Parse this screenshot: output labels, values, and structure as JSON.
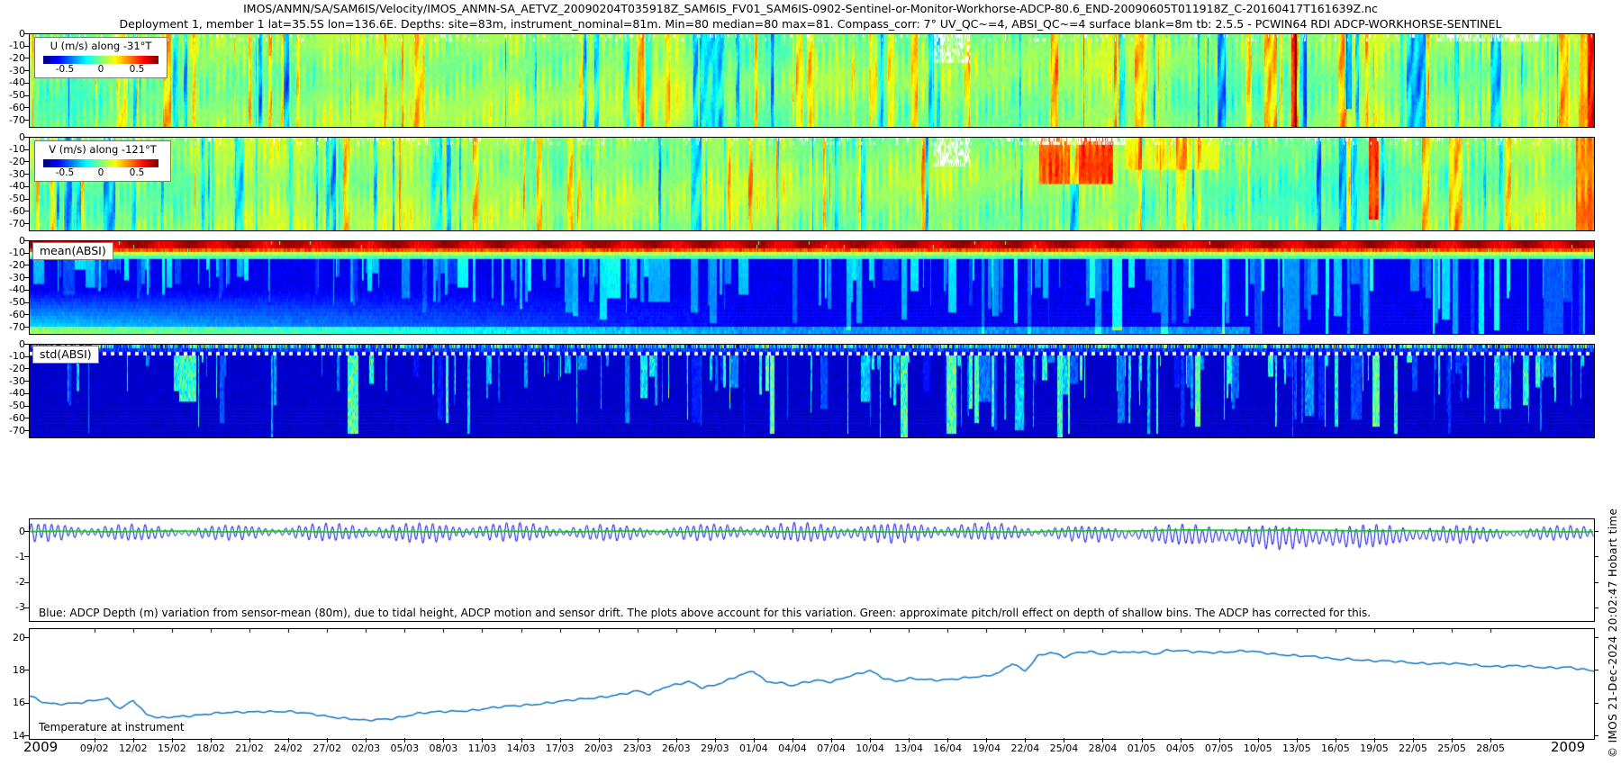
{
  "titles": {
    "line1": "IMOS/ANMN/SA/SAM6IS/Velocity/IMOS_ANMN-SA_AETVZ_20090204T035918Z_SAM6IS_FV01_SAM6IS-0902-Sentinel-or-Monitor-Workhorse-ADCP-80.6_END-20090605T011918Z_C-20160417T161639Z.nc",
    "line2": "Deployment 1, member 1 lat=35.5S lon=136.6E. Depths: site=83m, instrument_nominal=81m. Min=80 median=80 max=81. Compass_corr: 7° UV_QC~=4, ABSI_QC~=4 surface blank=8m tb: 2.5.5 - PCWIN64 RDI ADCP-WORKHORSE-SENTINEL"
  },
  "watermark": "© IMOS 21-Dec-2024 20:02:47 Hobart time",
  "axis": {
    "year_start": "2009",
    "year_end": "2009",
    "date_ticks": [
      "09/02",
      "12/02",
      "15/02",
      "18/02",
      "21/02",
      "24/02",
      "27/02",
      "02/03",
      "05/03",
      "08/03",
      "11/03",
      "14/03",
      "17/03",
      "20/03",
      "23/03",
      "26/03",
      "29/03",
      "01/04",
      "04/04",
      "07/04",
      "10/04",
      "13/04",
      "16/04",
      "19/04",
      "22/04",
      "25/04",
      "28/04",
      "01/05",
      "04/05",
      "07/05",
      "10/05",
      "13/05",
      "16/05",
      "19/05",
      "22/05",
      "25/05",
      "28/05"
    ],
    "depth_ticks": [
      "0",
      "-10",
      "-20",
      "-30",
      "-40",
      "-50",
      "-60",
      "-70"
    ],
    "depth_variation_ticks": [
      "0",
      "-1",
      "-2",
      "-3"
    ],
    "temperature_ticks": [
      "20",
      "18",
      "16",
      "14"
    ]
  },
  "labels": {
    "mean_absi": "mean(ABSI)",
    "std_absi": "std(ABSI)",
    "depth_note": "Blue: ADCP Depth (m) variation from sensor-mean (80m), due to tidal height, ADCP motion and sensor drift. The plots above account for this variation. Green: approximate pitch/roll effect on depth of shallow bins. The ADCP has corrected for this.",
    "temperature": "Temperature at instrument"
  },
  "legends": {
    "u": {
      "title": "U (m/s) along -31°T",
      "ticks": [
        "-0.5",
        "0",
        "0.5"
      ]
    },
    "v": {
      "title": "V (m/s) along -121°T",
      "ticks": [
        "-0.5",
        "0",
        "0.5"
      ]
    }
  },
  "colors": {
    "colormap": "jet",
    "depth_line_blue": "#0000dd",
    "pitch_roll_green": "#00cc00",
    "temperature_blue": "#1173bd",
    "panel_border": "#000000"
  },
  "chart_data": [
    {
      "type": "heatmap",
      "title": "U (m/s) along -31°T",
      "colormap": "jet",
      "value_range": [
        -0.8,
        0.8
      ],
      "colorbar_ticks": [
        -0.5,
        0,
        0.5
      ],
      "x_range": [
        "04/02/2009",
        "05/06/2009"
      ],
      "depth_range_m": [
        0,
        -75
      ],
      "y_ticks": [
        0,
        -10,
        -20,
        -30,
        -40,
        -50,
        -60,
        -70
      ],
      "summary": "Alongshore velocity, mostly green (-0.1 to +0.15 m/s) with dense vertical semidiurnal tidal striping; scattered cyan-blue and yellow columns; a red/blue column pair near 13/05; yellow-orange columns at the record end; white missing-data gaps in the shallowest bins, notably mid-April.",
      "render": {
        "seed": 7,
        "kind": "uv",
        "stripe_amp": 0.13,
        "specials": [
          {
            "t0": 0.806,
            "t1": 0.81,
            "r0": 0,
            "r1": 25,
            "dv": 0.55
          },
          {
            "t0": 0.812,
            "t1": 0.816,
            "r0": 0,
            "r1": 25,
            "dv": -0.45
          },
          {
            "t0": 0.84,
            "t1": 0.845,
            "r0": 0,
            "r1": 20,
            "dv": -0.4
          },
          {
            "t0": 0.99,
            "t1": 1.0,
            "r0": 0,
            "r1": 25,
            "dv": 0.25
          }
        ],
        "gaps": [
          {
            "t0": 0.578,
            "t1": 0.601,
            "rmax": 7
          },
          {
            "t0": 0.9,
            "t1": 0.965,
            "rmax": 1
          }
        ]
      }
    },
    {
      "type": "heatmap",
      "title": "V (m/s) along -121°T",
      "colormap": "jet",
      "value_range": [
        -0.8,
        0.8
      ],
      "colorbar_ticks": [
        -0.5,
        0,
        0.5
      ],
      "x_range": [
        "04/02/2009",
        "05/06/2009"
      ],
      "depth_range_m": [
        0,
        -75
      ],
      "y_ticks": [
        0,
        -10,
        -20,
        -30,
        -40,
        -50,
        -60,
        -70
      ],
      "summary": "Cross-shore velocity, mostly green with tidal striping; strong orange-red patch in the upper ~40 m around 23-28/04; a red column near 19/05; orange values through the water column at the record end; white gaps in the top bins mid-April.",
      "render": {
        "seed": 19,
        "kind": "uv",
        "stripe_amp": 0.13,
        "specials": [
          {
            "t0": 0.645,
            "t1": 0.692,
            "r0": 0,
            "r1": 12,
            "dv": 0.4
          },
          {
            "t0": 0.7,
            "t1": 0.76,
            "r0": 0,
            "r1": 8,
            "dv": 0.15
          },
          {
            "t0": 0.856,
            "t1": 0.862,
            "r0": 0,
            "r1": 22,
            "dv": 0.55
          },
          {
            "t0": 0.988,
            "t1": 1.0,
            "r0": 0,
            "r1": 25,
            "dv": 0.4
          }
        ],
        "gaps": [
          {
            "t0": 0.578,
            "t1": 0.601,
            "rmax": 7
          },
          {
            "t0": 0.64,
            "t1": 0.7,
            "rmax": 1
          }
        ]
      }
    },
    {
      "type": "heatmap",
      "label": "mean(ABSI)",
      "colormap": "jet",
      "x_range": [
        "04/02/2009",
        "05/06/2009"
      ],
      "depth_range_m": [
        0,
        -75
      ],
      "y_ticks": [
        0,
        -10,
        -20,
        -30,
        -40,
        -50,
        -60,
        -70
      ],
      "summary": "Mean acoustic backscatter: dark-red band in the top ~6 m, orange-yellow transition to ~12 m, deep-blue interior crossed by cyan tidal stripes that strengthen and reach deeper later in the record; green-teal lower layer from Feb to mid-March and along the deepest bins.",
      "render": {
        "seed": 31,
        "kind": "mean"
      }
    },
    {
      "type": "heatmap",
      "label": "std(ABSI)",
      "colormap": "jet",
      "x_range": [
        "04/02/2009",
        "05/06/2009"
      ],
      "depth_range_m": [
        0,
        -75
      ],
      "y_ticks": [
        0,
        -10,
        -20,
        -30,
        -40,
        -50,
        -60,
        -70
      ],
      "summary": "Backscatter standard deviation: uniformly dark navy with faint brighter-blue vertical streaks (more frequent from mid-April), mixed colour flecks in the top bins and a white dotted line near 8 m depth (surface blank).",
      "render": {
        "seed": 47,
        "kind": "std"
      }
    },
    {
      "type": "line",
      "ylim": [
        0.5,
        -3.5
      ],
      "y_ticks": [
        0,
        -1,
        -2,
        -3
      ],
      "x_range": [
        "04/02/2009",
        "05/06/2009"
      ],
      "series": [
        {
          "name": "ADCP depth (m) variation from sensor-mean (80m)",
          "color": "#0000dd",
          "behavior": "semidiurnal oscillation of amplitude 0.1-0.45 m with spring-neap modulation; deeper troughs to about -0.8 m from late April to mid May"
        },
        {
          "name": "approximate pitch/roll effect on depth of shallow bins",
          "color": "#00cc00",
          "behavior": "nearly flat at 0 m, slight positive offset late April to mid May"
        }
      ],
      "annotation": "Blue: ADCP Depth (m) variation from sensor-mean (80m), due to tidal height, ADCP motion and sensor drift. The plots above account for this variation. Green: approximate pitch/roll effect on depth of shallow bins. The ADCP has corrected for this.",
      "render": {
        "seed": 5,
        "cycles_per_day": 1.932,
        "spring_neap_period_days": 14.7
      }
    },
    {
      "type": "line",
      "label": "Temperature at instrument",
      "color": "#1173bd",
      "ylim": [
        20.55,
        13.85
      ],
      "y_ticks": [
        20,
        18,
        16,
        14
      ],
      "x_range": [
        "04/02/2009",
        "05/06/2009"
      ],
      "points": [
        [
          "04/02",
          16.45
        ],
        [
          "05/02",
          16.1
        ],
        [
          "06/02",
          16.0
        ],
        [
          "08/02",
          16.05
        ],
        [
          "10/02",
          16.3
        ],
        [
          "11/02",
          15.7
        ],
        [
          "12/02",
          16.25
        ],
        [
          "13/02",
          15.35
        ],
        [
          "14/02",
          15.1
        ],
        [
          "16/02",
          15.25
        ],
        [
          "18/02",
          15.4
        ],
        [
          "20/02",
          15.45
        ],
        [
          "22/02",
          15.55
        ],
        [
          "24/02",
          15.5
        ],
        [
          "26/02",
          15.35
        ],
        [
          "28/02",
          15.15
        ],
        [
          "02/03",
          14.95
        ],
        [
          "04/03",
          15.1
        ],
        [
          "06/03",
          15.4
        ],
        [
          "08/03",
          15.5
        ],
        [
          "10/03",
          15.6
        ],
        [
          "12/03",
          15.75
        ],
        [
          "14/03",
          15.9
        ],
        [
          "16/03",
          16.05
        ],
        [
          "18/03",
          16.2
        ],
        [
          "20/03",
          16.4
        ],
        [
          "22/03",
          16.6
        ],
        [
          "23/03",
          16.75
        ],
        [
          "24/03",
          16.55
        ],
        [
          "25/03",
          17.0
        ],
        [
          "26/03",
          17.2
        ],
        [
          "27/03",
          17.35
        ],
        [
          "28/03",
          16.95
        ],
        [
          "29/03",
          17.1
        ],
        [
          "30/03",
          17.45
        ],
        [
          "31/03",
          17.8
        ],
        [
          "01/04",
          18.0
        ],
        [
          "02/04",
          17.3
        ],
        [
          "03/04",
          17.25
        ],
        [
          "04/04",
          17.1
        ],
        [
          "05/04",
          17.35
        ],
        [
          "06/04",
          17.45
        ],
        [
          "07/04",
          17.3
        ],
        [
          "08/04",
          17.55
        ],
        [
          "09/04",
          17.8
        ],
        [
          "10/04",
          18.05
        ],
        [
          "11/04",
          17.6
        ],
        [
          "12/04",
          17.35
        ],
        [
          "13/04",
          17.5
        ],
        [
          "15/04",
          17.45
        ],
        [
          "17/04",
          17.55
        ],
        [
          "19/04",
          17.65
        ],
        [
          "20/04",
          17.9
        ],
        [
          "21/04",
          18.5
        ],
        [
          "22/04",
          18.0
        ],
        [
          "23/04",
          18.9
        ],
        [
          "24/04",
          19.1
        ],
        [
          "25/04",
          18.85
        ],
        [
          "26/04",
          19.15
        ],
        [
          "27/04",
          19.2
        ],
        [
          "28/04",
          19.0
        ],
        [
          "29/04",
          19.15
        ],
        [
          "30/04",
          19.1
        ],
        [
          "01/05",
          19.2
        ],
        [
          "02/05",
          19.05
        ],
        [
          "03/05",
          19.25
        ],
        [
          "04/05",
          19.2
        ],
        [
          "05/05",
          19.15
        ],
        [
          "07/05",
          19.15
        ],
        [
          "09/05",
          19.2
        ],
        [
          "11/05",
          19.05
        ],
        [
          "13/05",
          18.95
        ],
        [
          "15/05",
          18.8
        ],
        [
          "16/05",
          18.7
        ],
        [
          "17/05",
          18.75
        ],
        [
          "19/05",
          18.6
        ],
        [
          "21/05",
          18.55
        ],
        [
          "22/05",
          18.5
        ],
        [
          "24/05",
          18.45
        ],
        [
          "26/05",
          18.4
        ],
        [
          "28/05",
          18.3
        ],
        [
          "30/05",
          18.3
        ],
        [
          "01/06",
          18.2
        ],
        [
          "03/06",
          18.25
        ],
        [
          "05/06",
          17.95
        ]
      ]
    }
  ]
}
